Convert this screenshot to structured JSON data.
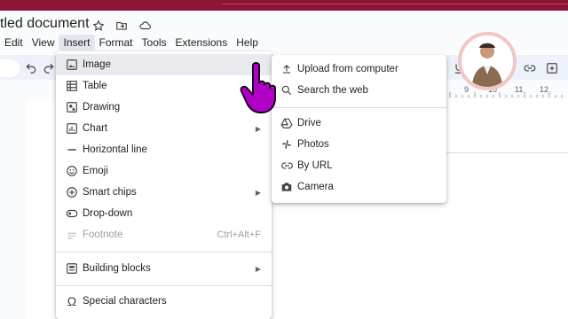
{
  "document": {
    "title": "tled document"
  },
  "menubar": {
    "items": [
      {
        "label": "Edit"
      },
      {
        "label": "View"
      },
      {
        "label": "Insert"
      },
      {
        "label": "Format"
      },
      {
        "label": "Tools"
      },
      {
        "label": "Extensions"
      },
      {
        "label": "Help"
      }
    ],
    "active_index": 2
  },
  "ruler": {
    "numbers": [
      "9",
      "10",
      "11",
      "12"
    ]
  },
  "insert_menu": {
    "items": [
      {
        "label": "Image",
        "icon": "image-icon",
        "submenu": true,
        "highlighted": true
      },
      {
        "label": "Table",
        "icon": "table-icon",
        "submenu": true
      },
      {
        "label": "Drawing",
        "icon": "drawing-icon",
        "submenu": true
      },
      {
        "label": "Chart",
        "icon": "chart-icon",
        "submenu": true
      },
      {
        "label": "Horizontal line",
        "icon": "horizontal-line-icon"
      },
      {
        "label": "Emoji",
        "icon": "emoji-icon"
      },
      {
        "label": "Smart chips",
        "icon": "smart-chips-icon",
        "submenu": true
      },
      {
        "label": "Drop-down",
        "icon": "dropdown-icon"
      },
      {
        "label": "Footnote",
        "icon": "footnote-icon",
        "shortcut": "Ctrl+Alt+F",
        "disabled": true
      },
      {
        "label": "Building blocks",
        "icon": "building-blocks-icon",
        "submenu": true
      },
      {
        "label": "Special characters",
        "icon": "omega-icon"
      }
    ]
  },
  "image_submenu": {
    "items": [
      {
        "label": "Upload from computer",
        "icon": "upload-icon"
      },
      {
        "label": "Search the web",
        "icon": "search-icon"
      },
      {
        "label": "Drive",
        "icon": "drive-icon"
      },
      {
        "label": "Photos",
        "icon": "photos-icon"
      },
      {
        "label": "By URL",
        "icon": "link-icon"
      },
      {
        "label": "Camera",
        "icon": "camera-icon"
      }
    ]
  },
  "colors": {
    "accent_bar": "#8c1438",
    "cursor": "#b000c8",
    "highlight": "#e8eaed"
  }
}
